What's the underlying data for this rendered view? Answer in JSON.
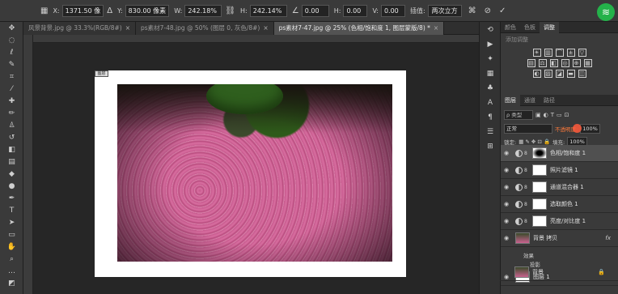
{
  "options_bar": {
    "x_label": "X:",
    "x_value": "1371.50 像",
    "y_label": "Y:",
    "y_value": "830.00 像素",
    "w_label": "W:",
    "w_value": "242.18%",
    "h_label": "H:",
    "h_value": "242.14%",
    "rot_value": "0.00",
    "hskew_label": "H:",
    "hskew_value": "0.00",
    "vskew_label": "V:",
    "vskew_value": "0.00",
    "interp_label": "插值:",
    "interp_value": "两次立方",
    "icons": [
      "reference-point-icon",
      "triangle-icon",
      "link-icon",
      "angle-icon",
      "warp-icon",
      "cancel-icon",
      "commit-icon",
      "wechat-icon"
    ]
  },
  "tabs": [
    {
      "label": "风景背景.jpg @ 33.3%(RGB/8#)",
      "close": "×",
      "active": false
    },
    {
      "label": "ps素材7-48.jpg @ 50% (图层 0, 灰色/8#)",
      "close": "×",
      "active": false
    },
    {
      "label": "ps素材7-47.jpg @ 25% (色相/饱和度 1, 图层蒙版/8) *",
      "close": "×",
      "active": true
    }
  ],
  "doc_label": "图层",
  "panel_tabs_top": [
    "颜色",
    "色板",
    "调整"
  ],
  "adjustments_title": "添加调整",
  "panel_tabs_layers": [
    "图层",
    "通道",
    "路径"
  ],
  "layers_panel": {
    "filter_label": "ρ 类型",
    "blend_mode": "正常",
    "opacity_label": "不透明度:",
    "opacity_value": "100%",
    "lock_label": "锁定:",
    "fill_label": "填充:",
    "fill_value": "100%"
  },
  "layers": [
    {
      "name": "色相/饱和度 1",
      "type": "adjustment",
      "selected": true
    },
    {
      "name": "照片滤镜 1",
      "type": "adjustment",
      "selected": false
    },
    {
      "name": "通道混合器 1",
      "type": "adjustment",
      "selected": false
    },
    {
      "name": "选取颜色 1",
      "type": "adjustment",
      "selected": false
    },
    {
      "name": "亮度/对比度 1",
      "type": "adjustment",
      "selected": false
    },
    {
      "name": "背景 拷贝",
      "type": "pixel",
      "selected": false,
      "fx": "fx"
    },
    {
      "name": "图层 1",
      "type": "pixel",
      "selected": false
    },
    {
      "name": "背景",
      "type": "pixel",
      "selected": false,
      "locked": true
    }
  ],
  "effects": {
    "title": "效果",
    "item": "投影"
  }
}
